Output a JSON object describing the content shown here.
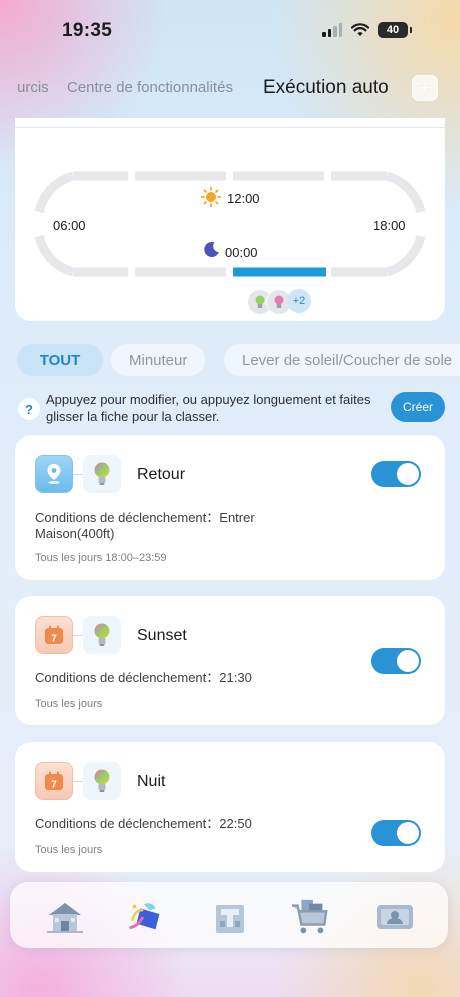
{
  "status_bar": {
    "time": "19:35",
    "battery": "40"
  },
  "top_tabs": [
    {
      "label": "urcis"
    },
    {
      "label": "Centre de fonctionnalités"
    },
    {
      "label": "Exécution auto"
    }
  ],
  "add_button_label": "+",
  "timeline": {
    "left_time": "06:00",
    "right_time": "18:00",
    "sun_time": "12:00",
    "moon_time": "00:00",
    "more_devices": "+2"
  },
  "filters": [
    {
      "label": "TOUT",
      "active": true
    },
    {
      "label": "Minuteur",
      "active": false
    },
    {
      "label": "Lever de soleil/Coucher de sole",
      "active": false
    }
  ],
  "hint": {
    "icon": "?",
    "text": "Appuyez pour modifier, ou appuyez longuement et faites glisser la fiche pour la classer.",
    "create_label": "Créer"
  },
  "automations": [
    {
      "trigger_icon": "location-pin-icon",
      "title": "Retour",
      "condition": "Conditions de déclenchement：Entrer Maison(400ft)",
      "schedule": "Tous les jours 18:00–23:59",
      "enabled": true
    },
    {
      "trigger_icon": "calendar-icon",
      "calendar_day": "7",
      "title": "Sunset",
      "condition": "Conditions de déclenchement：21:30",
      "schedule": "Tous les jours",
      "enabled": true
    },
    {
      "trigger_icon": "calendar-icon",
      "calendar_day": "7",
      "title": "Nuit",
      "condition": "Conditions de déclenchement：22:50",
      "schedule": "Tous les jours",
      "enabled": true
    }
  ],
  "bottom_nav": [
    {
      "icon": "home-icon"
    },
    {
      "icon": "magic-scene-icon"
    },
    {
      "icon": "building-icon"
    },
    {
      "icon": "shopping-cart-icon"
    },
    {
      "icon": "profile-card-icon"
    }
  ],
  "colors": {
    "accent": "#2a93d5",
    "sun": "#f5a623",
    "moon": "#4a55b8"
  }
}
